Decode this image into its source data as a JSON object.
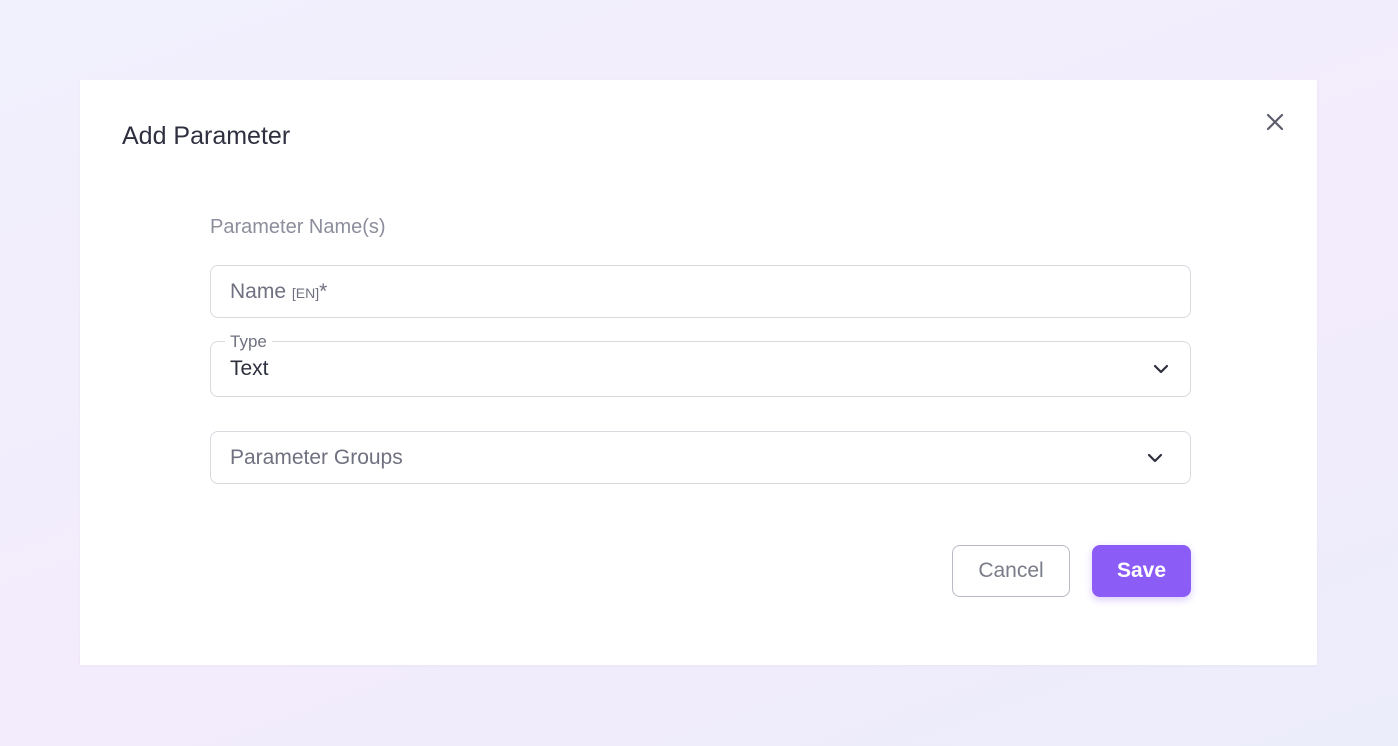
{
  "modal": {
    "title": "Add Parameter",
    "close_icon": "close-icon"
  },
  "form": {
    "section_label": "Parameter Name(s)",
    "name_field": {
      "placeholder": "Name",
      "lang_tag": "[EN]",
      "required_mark": "*",
      "value": ""
    },
    "type_field": {
      "label": "Type",
      "value": "Text",
      "icon": "chevron-down-icon"
    },
    "groups_field": {
      "placeholder": "Parameter Groups",
      "value": "",
      "icon": "chevron-down-icon"
    }
  },
  "actions": {
    "cancel_label": "Cancel",
    "save_label": "Save"
  },
  "colors": {
    "accent": "#8b5cf6",
    "title_text": "#2e2f3f",
    "muted_text": "#8c8e9c",
    "border": "#d9dae0"
  }
}
